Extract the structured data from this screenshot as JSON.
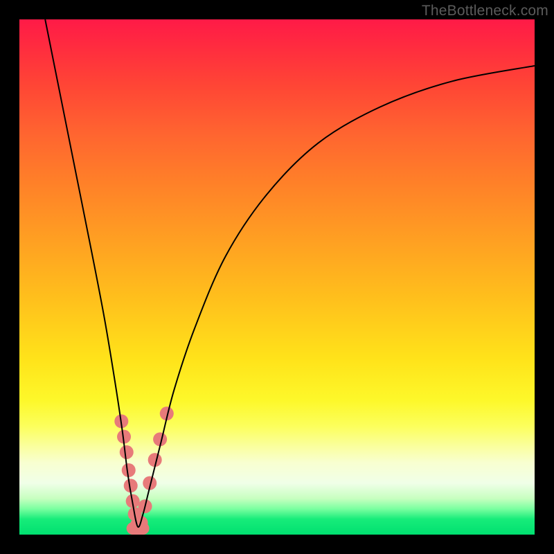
{
  "watermark": "TheBottleneck.com",
  "chart_data": {
    "type": "line",
    "title": "",
    "xlabel": "",
    "ylabel": "",
    "xlim": [
      0,
      100
    ],
    "ylim": [
      0,
      100
    ],
    "minimum_x": 23,
    "legend": false,
    "grid": false,
    "series": [
      {
        "name": "curve",
        "color": "#000000",
        "x": [
          5,
          8,
          11,
          14,
          16.5,
          18.5,
          20,
          21,
          22,
          23,
          24,
          25,
          26,
          27.5,
          30,
          34,
          40,
          48,
          58,
          70,
          84,
          100
        ],
        "y": [
          100,
          85,
          70,
          55,
          42,
          30,
          20,
          12,
          6,
          1.5,
          4,
          8,
          12,
          18,
          28,
          40,
          54,
          66,
          76,
          83,
          88,
          91
        ]
      }
    ],
    "markers": [
      {
        "name": "left-beads",
        "color": "#e77a7a",
        "r": 10,
        "points": [
          {
            "x": 19.8,
            "y": 22
          },
          {
            "x": 20.3,
            "y": 19
          },
          {
            "x": 20.8,
            "y": 16
          },
          {
            "x": 21.2,
            "y": 12.5
          },
          {
            "x": 21.6,
            "y": 9.5
          },
          {
            "x": 22.0,
            "y": 6.5
          },
          {
            "x": 22.4,
            "y": 4.0
          },
          {
            "x": 22.9,
            "y": 2.0
          }
        ]
      },
      {
        "name": "right-beads",
        "color": "#e77a7a",
        "r": 10,
        "points": [
          {
            "x": 23.6,
            "y": 2.3
          },
          {
            "x": 24.4,
            "y": 5.5
          },
          {
            "x": 25.3,
            "y": 10.0
          },
          {
            "x": 26.3,
            "y": 14.5
          },
          {
            "x": 27.3,
            "y": 18.5
          },
          {
            "x": 28.6,
            "y": 23.5
          }
        ]
      },
      {
        "name": "bottom-beads",
        "color": "#e77a7a",
        "r": 9,
        "points": [
          {
            "x": 22.0,
            "y": 1.2
          },
          {
            "x": 23.0,
            "y": 0.9
          },
          {
            "x": 24.0,
            "y": 1.2
          }
        ]
      }
    ]
  }
}
